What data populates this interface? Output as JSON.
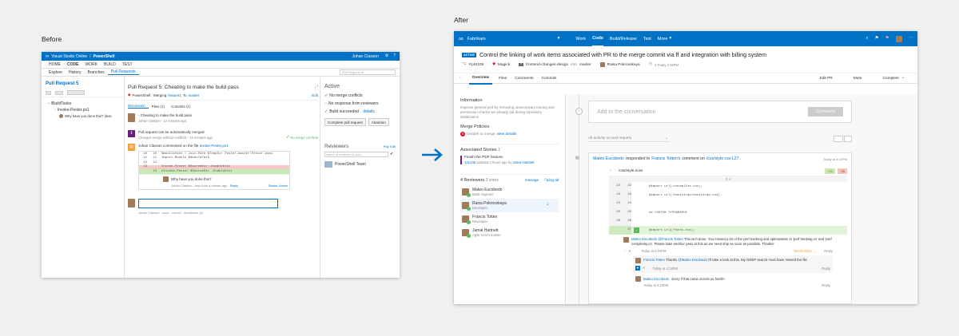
{
  "captions": {
    "before": "Before",
    "after": "After"
  },
  "before": {
    "brand": "Visual Studio Online",
    "sep": "/",
    "project": "PowerShell",
    "user": "Johan Classon",
    "nav": [
      "HOME",
      "CODE",
      "WORK",
      "BUILD",
      "TEST"
    ],
    "subnav": [
      "Explore",
      "History",
      "Branches",
      "Pull Requests"
    ],
    "search_placeholder": "Pull Request Id",
    "sidebar": {
      "title": "Pull Request 5",
      "folder": "/BuildTasks",
      "file": "Invoke-Pester.ps1",
      "comment": "Why have you done this? (less"
    },
    "pr": {
      "title": "Pull Request 5: Cheating to make the build pass",
      "source": "PowerShell : Merging",
      "branch1": "feature1",
      "to": "To",
      "branch2": "master",
      "edit": "Edit",
      "tabs": [
        "Discussion",
        "Files (1)",
        "Commits (1)"
      ],
      "msg1": "- Cheating to make the build pass",
      "msg1_meta": "Johan Classon - 12 minutes ago",
      "merge_text": "Pull request can be automatically merged",
      "merge_meta": "Changes merge without conflicts - 12 minutes ago",
      "no_conflicts": "No merge conflicts",
      "commented": "Johan Classon commented on the file",
      "commented_file": "Invoke-Pester.ps1",
      "code": [
        {
          "n": "10",
          "m": "10",
          "t": "$moduleFath = Join-Path $TempDir Pester-master\\Pester.psm1",
          "k": ""
        },
        {
          "n": "11",
          "m": "11",
          "t": "Import-Module $moduleFath",
          "k": ""
        },
        {
          "n": "12",
          "m": "12",
          "t": "",
          "k": ""
        },
        {
          "n": "13",
          "m": "",
          "t": "Invoke-Pester $SourceDir -EnableExit",
          "k": "del"
        },
        {
          "n": "",
          "m": "13",
          "t": "#Invoke-Pester $SourceDir -EnableExit",
          "k": "add"
        }
      ],
      "q": "Why have you done this?",
      "q_meta": "Johan Classon - less than a minute ago -",
      "reply": "Reply",
      "status": "Status: Active",
      "footer": "Johan Classon - save - cancel - workitems (#)"
    },
    "right": {
      "title": "Active",
      "items": [
        "No merge conflicts",
        "No response from reviewers",
        "Build succeeded"
      ],
      "details": "details",
      "complete": "Complete pull request",
      "abandon": "Abandon",
      "reviewers": "Reviewers",
      "pay": "Pay",
      "edit": "Edit",
      "reviewer_ph": "Name of reviewer to add",
      "team": "PowerShell Team"
    }
  },
  "after": {
    "brand": "Fabrikam",
    "nav": [
      "Work",
      "Code",
      "Build/Release",
      "Test",
      "More"
    ],
    "active": "ACTIVE",
    "title": "Control the linking of work items associated with PR to the merge commit via ff and integration with billing system",
    "id": "#140105",
    "magick": "Magick",
    "branch": "frontend-changes-design",
    "into": "into",
    "target": "master",
    "author": "Raisa Pokrovskaya",
    "time": "4 Today 2:34PM",
    "tabs": [
      "Overview",
      "Files",
      "Comments",
      "Commits"
    ],
    "edit": "Edit PR",
    "mute": "Mute",
    "complete": "Complete",
    "info_t": "Information",
    "info": "Improve general perf by removing unnecessary tracing and permission checks we already did during repository initialization",
    "policies": "Merge Policies",
    "unable": "Unable to merge",
    "view_details": "view details",
    "stories": "Associated Stories",
    "stories_n": "1",
    "story": "Finish the PDF feature.",
    "story_id": "141235",
    "story_meta": "updated 2 hours ago by",
    "story_by": "Jamal Hartnett",
    "rev_t": "4 Reviewers",
    "votes": "3 votes",
    "manage": "manage",
    "ping": "ping all",
    "reviewers": [
      {
        "name": "Mateo Escobedo",
        "role": "Build engineer"
      },
      {
        "name": "Raisa Pokrovskaya",
        "role": "Developer"
      },
      {
        "name": "Francis Totten",
        "role": "Developer"
      },
      {
        "name": "Jamal Hartnett",
        "role": "Agile scrum master"
      }
    ],
    "add_conv": "Add to the conversation",
    "comment_btn": "Comment",
    "filter": "All activity on pull request",
    "resp": {
      "who": "Mateo Escobedo",
      "mid": "responded to",
      "target": "Francis Totten's",
      "mid2": "comment on",
      "file": "/css/style.css L27.",
      "time": "Today at 4:04PM"
    },
    "file": "/css/style.scss",
    "add": "+12",
    "del": "-26",
    "lines": [
      {
        "a": "22",
        "b": "22",
        "t": "@import url(/normalize.css);"
      },
      {
        "a": "23",
        "b": "23",
        "t": "@import url(/bootstrap/bootstrap.css);"
      },
      {
        "a": "24",
        "b": "24",
        "t": ""
      },
      {
        "a": "25",
        "b": "25",
        "t": "## CUSTOM TYPOGRAPHY"
      },
      {
        "a": "26",
        "b": "26",
        "t": ""
      },
      {
        "a": "",
        "b": "27",
        "t": "@import url(/fonts.css);"
      }
    ],
    "c1": {
      "who": "Mateo Escobedo",
      "mention": "@Francis Totten",
      "text": "This isn't done. You missed a lot of the perf tracking and optimization in 'perf tracking.cs' and 'perf complexity.cs'. Please take another pass at this as we need ship as soon as possible. Thanks!",
      "time": "Today at 4:04PM",
      "likes": "5",
      "status": "Needs More",
      "reply": "Reply"
    },
    "c2": {
      "who": "Francis Totten",
      "text": "Thanks",
      "mention": "@Mateo Escobedo",
      "text2": "I'll take a look at this. My GREP search must have missed the file.",
      "time": "Today at 4:12PM",
      "reply": "Reply"
    },
    "c3": {
      "who": "Mateo Escobedo",
      "text": "Sorry if that came across as harsh!",
      "time": "Today at 4:18PM",
      "reply": "Reply"
    }
  },
  "colors": {
    "blue": "#0072c6",
    "green": "#5cb85c",
    "red": "#e81123",
    "orange": "#f6a03a",
    "purple": "#68217a"
  }
}
